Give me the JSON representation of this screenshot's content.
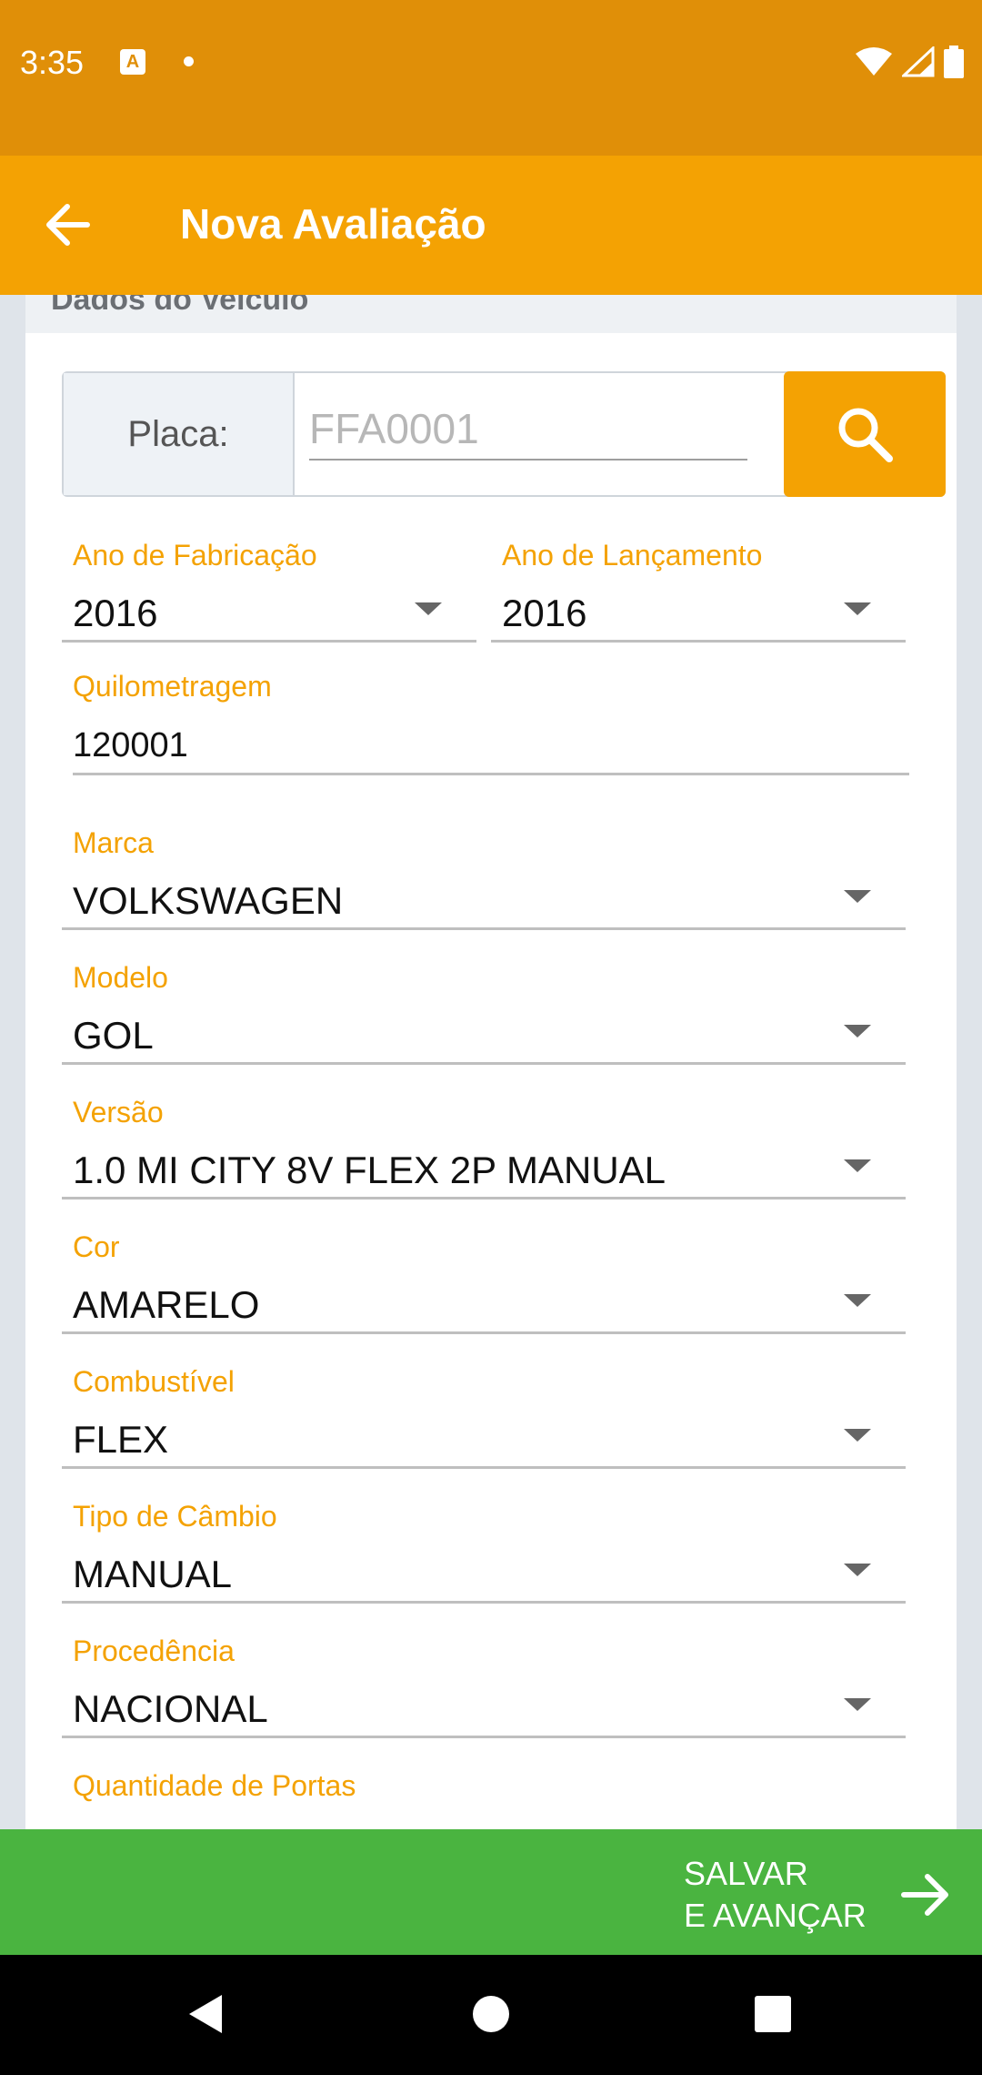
{
  "status_bar": {
    "time": "3:35",
    "icons": [
      "a-notification-icon",
      "dot-icon",
      "wifi-icon",
      "signal-icon",
      "battery-icon"
    ]
  },
  "app_bar": {
    "title": "Nova Avaliação",
    "back_icon": "arrow-left-icon"
  },
  "section": {
    "title": "Dados do Veículo"
  },
  "plate": {
    "label": "Placa:",
    "placeholder": "FFA0001",
    "value": "",
    "search_icon": "search-icon"
  },
  "fields": {
    "ano_fabricacao": {
      "label": "Ano de Fabricação",
      "value": "2016"
    },
    "ano_lancamento": {
      "label": "Ano de Lançamento",
      "value": "2016"
    },
    "quilometragem": {
      "label": "Quilometragem",
      "value": "120001"
    },
    "marca": {
      "label": "Marca",
      "value": "VOLKSWAGEN"
    },
    "modelo": {
      "label": "Modelo",
      "value": "GOL"
    },
    "versao": {
      "label": "Versão",
      "value": "1.0 MI CITY 8V FLEX 2P MANUAL"
    },
    "cor": {
      "label": "Cor",
      "value": "AMARELO"
    },
    "combustivel": {
      "label": "Combustível",
      "value": "FLEX"
    },
    "tipo_cambio": {
      "label": "Tipo de Câmbio",
      "value": "MANUAL"
    },
    "procedencia": {
      "label": "Procedência",
      "value": "NACIONAL"
    },
    "quantidade_portas": {
      "label": "Quantidade de Portas",
      "value": ""
    }
  },
  "save_button": {
    "line1": "SALVAR",
    "line2": "E AVANÇAR",
    "icon": "arrow-right-icon"
  },
  "colors": {
    "status_bar": "#e08f08",
    "app_bar": "#f4a203",
    "accent": "#f4a203",
    "save_bar": "#4ab440",
    "nav_bar": "#000000"
  },
  "nav_bar": {
    "icons": [
      "back-triangle-icon",
      "home-circle-icon",
      "recents-square-icon"
    ]
  }
}
